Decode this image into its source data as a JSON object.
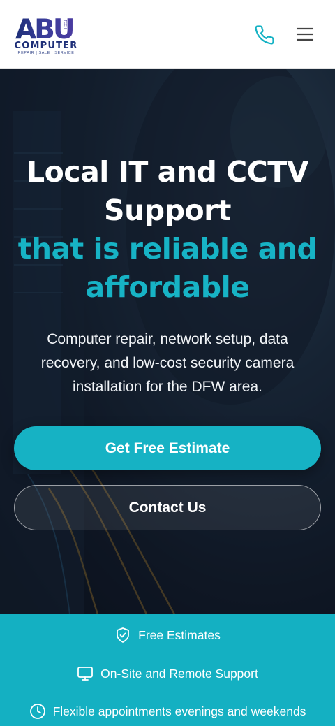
{
  "header": {
    "logo_letters": "ABU",
    "logo_small": "TECH",
    "logo_word": "COMPUTER",
    "logo_tagline": "REPAIR | SALE | SERVICE",
    "phone_icon": "phone-icon",
    "menu_icon": "hamburger-menu-icon"
  },
  "hero": {
    "title_line1": "Local IT and CCTV",
    "title_line2": "Support",
    "title_accent_line1": "that is reliable and",
    "title_accent_line2": "affordable",
    "subtitle_line1": "Computer repair, network setup, data",
    "subtitle_line2": "recovery, and low-cost security camera",
    "subtitle_line3": "installation for the DFW area.",
    "primary_cta": "Get Free Estimate",
    "secondary_cta": "Contact Us"
  },
  "features": [
    {
      "icon": "shield-check-icon",
      "label": "Free Estimates"
    },
    {
      "icon": "monitor-icon",
      "label": "On-Site and Remote Support"
    },
    {
      "icon": "clock-icon",
      "label": "Flexible appointments evenings and weekends"
    }
  ],
  "colors": {
    "accent": "#16b2c4",
    "logo_navy": "#1e2f78",
    "logo_purple": "#4a3ba0",
    "hero_dark": "#141f2e",
    "white": "#ffffff"
  }
}
